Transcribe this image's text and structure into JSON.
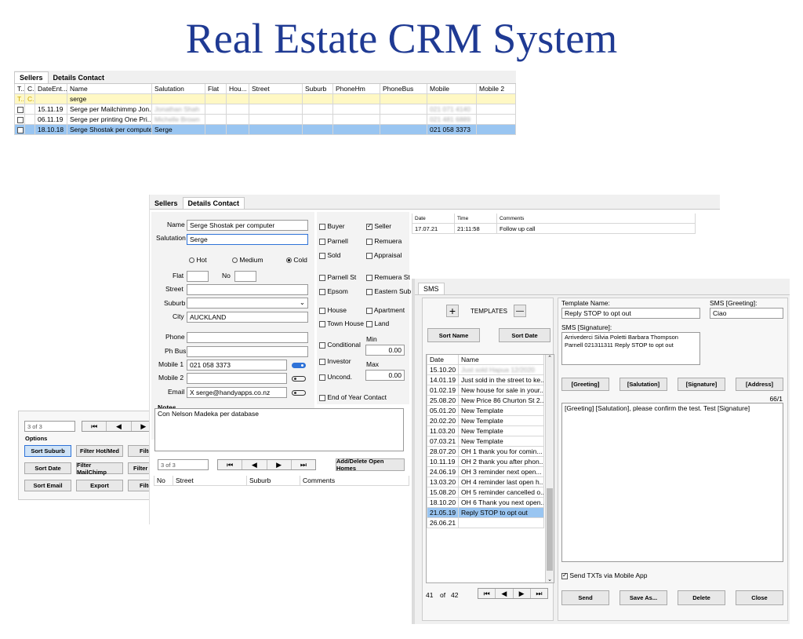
{
  "title": "Real Estate CRM System",
  "window1": {
    "tabs": [
      "Sellers",
      "Details Contact"
    ],
    "columns": [
      "T..",
      "C..",
      "DateEnt...",
      "Name",
      "Salutation",
      "Flat",
      "Hou...",
      "Street",
      "Suburb",
      "PhoneHm",
      "PhoneBus",
      "Mobile",
      "Mobile 2"
    ],
    "filter_row": {
      "t": "T..",
      "c": "C..",
      "name": "serge"
    },
    "rows": [
      {
        "date": "15.11.19",
        "name": "Serge per Mailchimmp Jon...",
        "salutation": "Jonathan Shah",
        "mobile": "021 071 4140"
      },
      {
        "date": "06.11.19",
        "name": "Serge per printing One Pri...",
        "salutation": "Michelle Brown",
        "mobile": "021 481 6889"
      },
      {
        "date": "18.10.18",
        "name": "Serge Shostak per computer",
        "salutation": "Serge",
        "mobile": "021 058 3373"
      }
    ],
    "record_count": "3 of 3",
    "options_label": "Options",
    "buttons": [
      "Sort Suburb",
      "Filter Hot/Med",
      "Filter",
      "Sort Date",
      "Filter MailChimp",
      "Filter M",
      "Sort Email",
      "Export",
      "Filter"
    ]
  },
  "window2": {
    "tabs": [
      "Sellers",
      "Details Contact"
    ],
    "name_label": "Name",
    "name_value": "Serge Shostak per computer",
    "salutation_label": "Salutation",
    "salutation_value": "Serge",
    "radio_hot": "Hot",
    "radio_medium": "Medium",
    "radio_cold": "Cold",
    "flat_label": "Flat",
    "no_label": "No",
    "street_label": "Street",
    "suburb_label": "Suburb",
    "city_label": "City",
    "city_value": "AUCKLAND",
    "phone_label": "Phone",
    "phbus_label": "Ph Bus",
    "mobile1_label": "Mobile 1",
    "mobile1_value": "021 058 3373",
    "mobile2_label": "Mobile 2",
    "email_label": "Email",
    "email_value": "X serge@handyapps.co.nz",
    "checks": {
      "buyer": "Buyer",
      "seller": "Seller",
      "parnell": "Parnell",
      "remuera": "Remuera",
      "sold": "Sold",
      "appraisal": "Appraisal",
      "parnell_st": "Parnell St",
      "remuera_st": "Remuera St",
      "epsom": "Epsom",
      "eastern_sub": "Eastern Sub",
      "house": "House",
      "apartment": "Apartment",
      "town_house": "Town House",
      "land": "Land",
      "conditional": "Conditional",
      "investor": "Investor",
      "uncond": "Uncond.",
      "end_of_year": "End of Year Contact"
    },
    "min_label": "Min",
    "min_value": "0.00",
    "max_label": "Max",
    "max_value": "0.00",
    "notes_label": "Notes",
    "notes_value": "Con Nelson Madeka per database",
    "record_count": "3 of 3",
    "open_homes_button": "Add/Delete Open Homes",
    "open_columns": [
      "No",
      "Street",
      "Suburb",
      "Comments"
    ],
    "comments_columns": [
      "Date",
      "Time",
      "Comments"
    ],
    "comments_rows": [
      {
        "date": "17.07.21",
        "time": "21:11:58",
        "comment": "Follow up call"
      }
    ]
  },
  "window3": {
    "tab": "SMS",
    "templates_label": "TEMPLATES",
    "add_icon": "+",
    "remove_icon": "—",
    "sort_name": "Sort Name",
    "sort_date": "Sort Date",
    "columns": [
      "Date",
      "Name"
    ],
    "rows": [
      {
        "date": "15.10.20",
        "name": "Just sold Hapua 12/2020"
      },
      {
        "date": "14.01.19",
        "name": "Just sold in the street to ke..."
      },
      {
        "date": "01.02.19",
        "name": "New house for sale in your..."
      },
      {
        "date": "25.08.20",
        "name": "New Price 86 Churton St 2..."
      },
      {
        "date": "05.01.20",
        "name": "New Template"
      },
      {
        "date": "20.02.20",
        "name": "New Template"
      },
      {
        "date": "11.03.20",
        "name": "New Template"
      },
      {
        "date": "07.03.21",
        "name": "New Template"
      },
      {
        "date": "28.07.20",
        "name": "OH 1 thank you for comin..."
      },
      {
        "date": "10.11.19",
        "name": "OH 2 thank you after phon..."
      },
      {
        "date": "24.06.19",
        "name": "OH 3 reminder next open..."
      },
      {
        "date": "13.03.20",
        "name": "OH 4 reminder last open h..."
      },
      {
        "date": "15.08.20",
        "name": "OH 5 reminder cancelled o..."
      },
      {
        "date": "18.10.20",
        "name": "OH 6 Thank you next open..."
      },
      {
        "date": "21.05.19",
        "name": "Reply STOP to opt out"
      },
      {
        "date": "26.06.21",
        "name": ""
      }
    ],
    "counter_current": "41",
    "counter_of": "of",
    "counter_total": "42",
    "template_name_label": "Template Name:",
    "template_name_value": "Reply STOP to opt out",
    "greeting_label": "SMS [Greeting]:",
    "greeting_value": "Ciao",
    "signature_label": "SMS [Signature]:",
    "signature_value": "Arrivederci Silvia Poletti Barbara Thompson Parnell 021311311 Reply STOP to opt out",
    "tag_buttons": [
      "[Greeting]",
      "[Salutation]",
      "[Signature]",
      "[Address]"
    ],
    "char_count": "66/1",
    "message": "[Greeting] [Salutation], please confirm the test. Test [Signature]",
    "send_via_app": "Send TXTs via Mobile App",
    "actions": [
      "Send",
      "Save As...",
      "Delete",
      "Close"
    ]
  },
  "colors": {
    "title": "#1f3a93",
    "selected": "#99c5f1",
    "filter_row": "#fff8c4",
    "toggle_on": "#2f73d8"
  }
}
